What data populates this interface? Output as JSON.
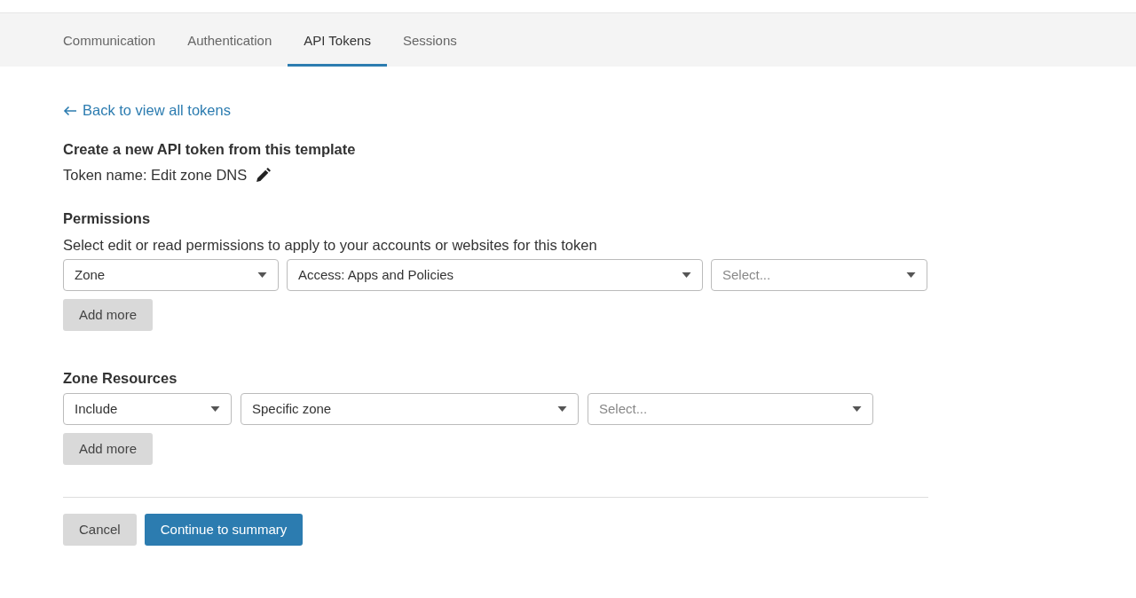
{
  "tabs": [
    {
      "label": "Communication",
      "selected": false
    },
    {
      "label": "Authentication",
      "selected": false
    },
    {
      "label": "API Tokens",
      "selected": true
    },
    {
      "label": "Sessions",
      "selected": false
    }
  ],
  "back_link": "Back to view all tokens",
  "heading": "Create a new API token from this template",
  "token_name": "Token name: Edit zone DNS",
  "sections": [
    {
      "title": "Permissions",
      "description": "Select edit or read permissions to apply to your accounts or websites for this token",
      "selects": [
        {
          "value": "Zone"
        },
        {
          "value": "Access: Apps and Policies"
        },
        {
          "placeholder": "Select..."
        }
      ],
      "add_button": "Add more"
    },
    {
      "title": "Zone Resources",
      "selects": [
        {
          "value": "Include"
        },
        {
          "value": "Specific zone"
        },
        {
          "placeholder": "Select..."
        }
      ],
      "add_button": "Add more"
    }
  ],
  "buttons": {
    "cancel": "Cancel",
    "continue": "Continue to summary"
  }
}
